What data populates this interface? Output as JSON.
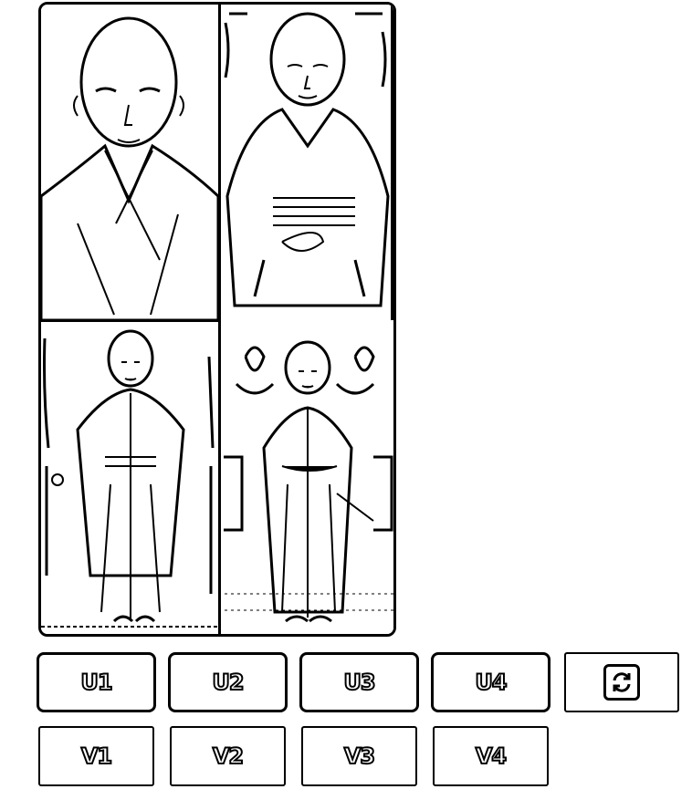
{
  "upscale_buttons": [
    "U1",
    "U2",
    "U3",
    "U4"
  ],
  "variation_buttons": [
    "V1",
    "V2",
    "V3",
    "V4"
  ],
  "refresh_icon": "refresh-icon",
  "images": [
    "image-1",
    "image-2",
    "image-3",
    "image-4"
  ]
}
